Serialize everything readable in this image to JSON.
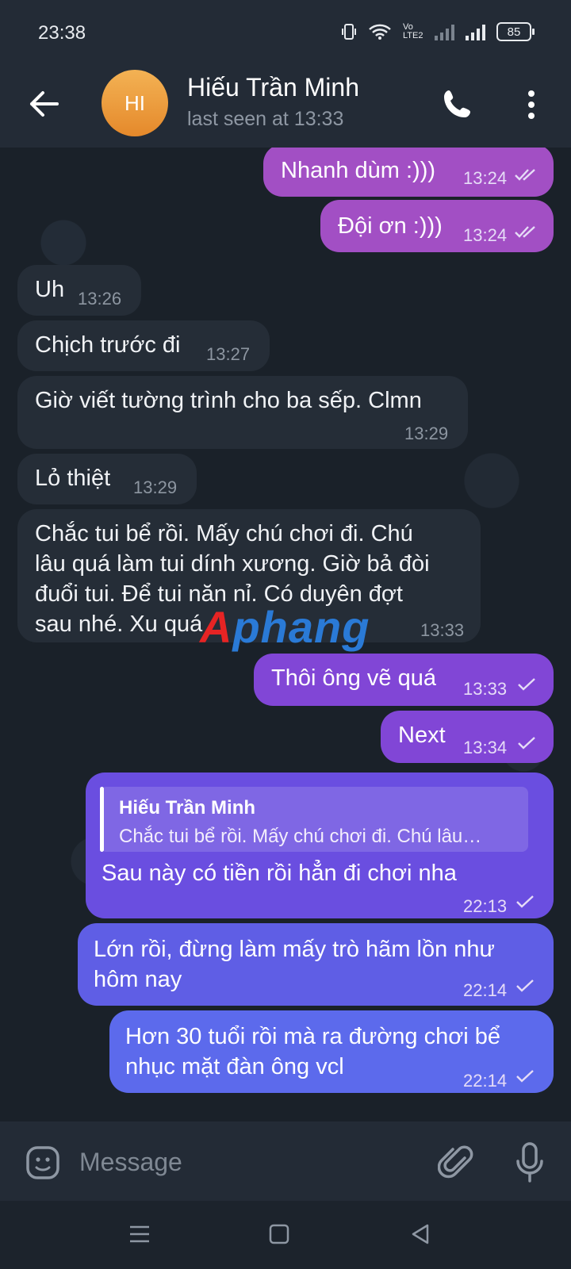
{
  "status_bar": {
    "time": "23:38",
    "volte": "Vo LTE2",
    "battery": "85"
  },
  "header": {
    "avatar_initials": "HI",
    "avatar_color": "#EE9A3C",
    "name": "Hiếu Trần Minh",
    "status": "last seen at 13:33"
  },
  "messages": [
    {
      "dir": "out",
      "text": "Nhanh dùm :)))",
      "time": "13:24",
      "ticks": "double"
    },
    {
      "dir": "out",
      "text": "Đội ơn :)))",
      "time": "13:24",
      "ticks": "double"
    },
    {
      "dir": "in",
      "text": "Uh",
      "time": "13:26"
    },
    {
      "dir": "in",
      "text": "Chịch trước đi",
      "time": "13:27"
    },
    {
      "dir": "in",
      "text": "Giờ viết tường trình cho ba sếp. Clmn",
      "time": "13:29"
    },
    {
      "dir": "in",
      "text": "Lỏ thiệt",
      "time": "13:29"
    },
    {
      "dir": "in",
      "lines": [
        "Chắc tui bể rồi. Mấy chú chơi đi. Chú",
        "lâu quá làm tui dính xương. Giờ bả đòi",
        "đuổi tui. Để tui năn nỉ. Có duyên đợt",
        "sau nhé. Xu quá"
      ],
      "time": "13:33"
    },
    {
      "dir": "out",
      "text": "Thôi ông vẽ quá",
      "time": "13:33",
      "ticks": "single"
    },
    {
      "dir": "out",
      "text": "Next",
      "time": "13:34",
      "ticks": "single"
    },
    {
      "dir": "out",
      "reply_to": {
        "name": "Hiếu Trần Minh",
        "text": "Chắc tui bể rồi. Mấy chú chơi đi. Chú lâu…"
      },
      "text": "Sau này có tiền rồi hẳn đi chơi nha",
      "time": "22:13",
      "ticks": "single"
    },
    {
      "dir": "out",
      "lines": [
        "Lớn rồi, đừng làm mấy trò hãm lồn như",
        "hôm nay"
      ],
      "time": "22:14",
      "ticks": "single"
    },
    {
      "dir": "out",
      "lines": [
        "Hơn 30 tuổi rồi mà ra đường chơi bể",
        "nhục mặt đàn ông vcl"
      ],
      "time": "22:14",
      "ticks": "single"
    }
  ],
  "watermark": {
    "part1": "A",
    "part2": "phang"
  },
  "input": {
    "placeholder": "Message"
  },
  "colors": {
    "outgoing_bubble_top": "#A24FC4",
    "outgoing_bubble_bottom": "#5C6AEC",
    "incoming_bubble": "#252D37",
    "chat_background": "#1A2129"
  }
}
